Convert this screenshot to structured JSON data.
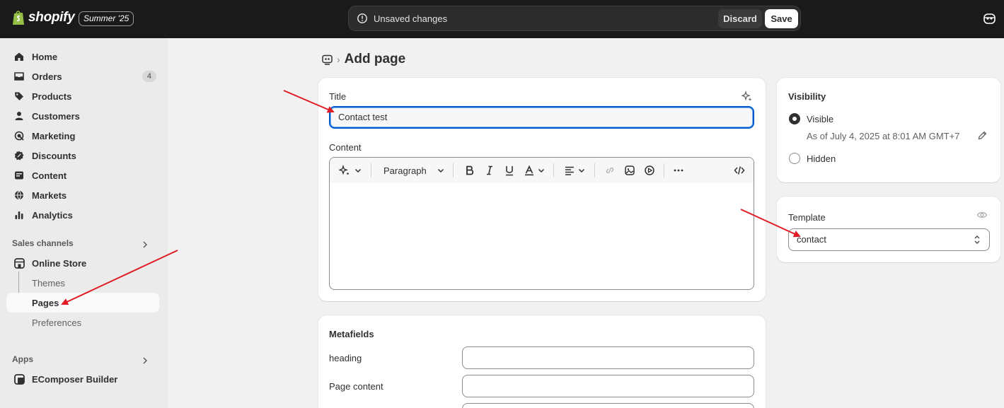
{
  "topbar": {
    "brand": "shopify",
    "edition_badge": "Summer '25",
    "unsaved_text": "Unsaved changes",
    "discard_label": "Discard",
    "save_label": "Save"
  },
  "sidebar": {
    "items": [
      {
        "label": "Home",
        "icon": "home-icon"
      },
      {
        "label": "Orders",
        "icon": "inbox-icon",
        "count": "4"
      },
      {
        "label": "Products",
        "icon": "tag-icon"
      },
      {
        "label": "Customers",
        "icon": "person-icon"
      },
      {
        "label": "Marketing",
        "icon": "target-icon"
      },
      {
        "label": "Discounts",
        "icon": "discount-icon"
      },
      {
        "label": "Content",
        "icon": "content-icon"
      },
      {
        "label": "Markets",
        "icon": "globe-icon"
      },
      {
        "label": "Analytics",
        "icon": "bar-chart-icon"
      }
    ],
    "sales_channels_heading": "Sales channels",
    "online_store": {
      "label": "Online Store",
      "subitems": [
        "Themes",
        "Pages",
        "Preferences"
      ]
    },
    "apps_heading": "Apps",
    "apps": [
      {
        "label": "EComposer Builder"
      }
    ]
  },
  "page": {
    "title": "Add page"
  },
  "form": {
    "title_label": "Title",
    "title_value": "Contact test",
    "content_label": "Content",
    "paragraph_select": "Paragraph"
  },
  "metafields": {
    "heading": "Metafields",
    "fields": [
      {
        "label": "heading",
        "value": ""
      },
      {
        "label": "Page content",
        "value": ""
      }
    ]
  },
  "visibility": {
    "heading": "Visibility",
    "visible_label": "Visible",
    "visible_date": "As of July 4, 2025 at 8:01 AM GMT+7",
    "hidden_label": "Hidden",
    "selected": "visible"
  },
  "template": {
    "heading": "Template",
    "value": "contact"
  },
  "colors": {
    "topbar_bg": "#1a1a1a",
    "focus_blue": "#005bd3",
    "annotation_red": "#e01b24",
    "brand_green": "#95bf47"
  }
}
